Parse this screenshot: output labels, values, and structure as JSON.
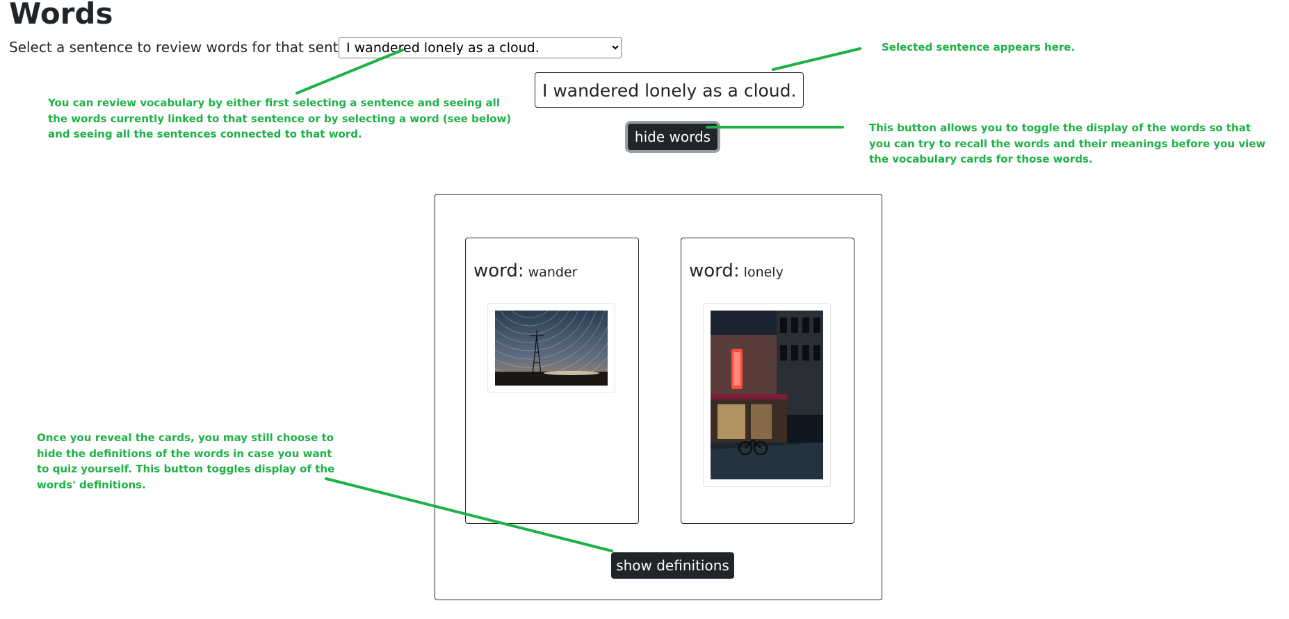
{
  "page": {
    "title": "Words",
    "prompt": "Select a sentence to review words for that sentence:"
  },
  "sentence_select": {
    "selected": "I wandered lonely as a cloud."
  },
  "selected_sentence": "I wandered lonely as a cloud.",
  "buttons": {
    "hide_words": "hide words",
    "show_definitions": "show definitions"
  },
  "cards": [
    {
      "key_label": "word:",
      "word": "wander",
      "image_icon": "windmill-star-trails-photo"
    },
    {
      "key_label": "word:",
      "word": "lonely",
      "image_icon": "night-street-shop-photo"
    }
  ],
  "annotations": {
    "select_note": "You can review vocabulary by either first selecting a sentence and seeing all the words currently linked to that sentence or by selecting a word (see below) and seeing all the sentences connected to that word.",
    "selected_note": "Selected sentence appears here.",
    "hide_note": "This button allows you to toggle the display of the words so that you can try to recall the words and their meanings before you view the vocabulary cards for those words.",
    "defs_note": "Once you reveal the cards, you may still choose to hide the definitions of the words in case you want to quiz yourself. This button toggles display of the words' definitions."
  },
  "colors": {
    "annotation_green": "#1db146",
    "button_dark": "#212529"
  }
}
